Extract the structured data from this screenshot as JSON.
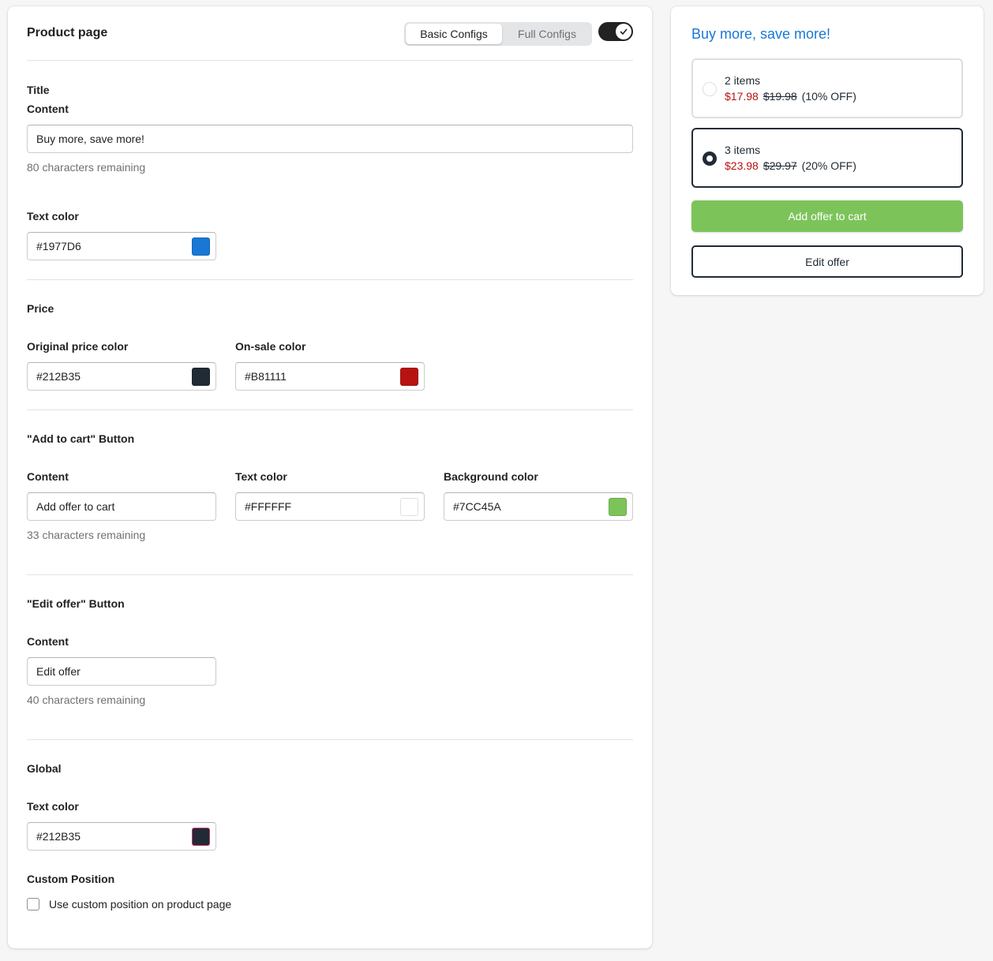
{
  "header": {
    "title": "Product page",
    "tabs": [
      {
        "label": "Basic Configs",
        "active": true
      },
      {
        "label": "Full Configs",
        "active": false
      }
    ],
    "toggle_on": true
  },
  "title_section": {
    "heading": "Title",
    "content_label": "Content",
    "content_value": "Buy more, save more!",
    "remaining": "80 characters remaining",
    "text_color_label": "Text color",
    "text_color": "#1977D6"
  },
  "price_section": {
    "heading": "Price",
    "original_label": "Original price color",
    "original_color": "#212B35",
    "sale_label": "On-sale color",
    "sale_color": "#B81111"
  },
  "add_to_cart_section": {
    "heading": "\"Add to cart\" Button",
    "content_label": "Content",
    "content_value": "Add offer to cart",
    "remaining": "33 characters remaining",
    "text_color_label": "Text color",
    "text_color": "#FFFFFF",
    "bg_color_label": "Background color",
    "bg_color": "#7CC45A"
  },
  "edit_offer_section": {
    "heading": "\"Edit offer\" Button",
    "content_label": "Content",
    "content_value": "Edit offer",
    "remaining": "40 characters remaining"
  },
  "global_section": {
    "heading": "Global",
    "text_color_label": "Text color",
    "text_color": "#212B35",
    "custom_position_heading": "Custom Position",
    "custom_position_label": "Use custom position on product page",
    "custom_position_checked": false
  },
  "preview": {
    "title": "Buy more, save more!",
    "options": [
      {
        "qty": "2 items",
        "sale_price": "$17.98",
        "original_price": "$19.98",
        "discount": "(10% OFF)",
        "selected": false
      },
      {
        "qty": "3 items",
        "sale_price": "$23.98",
        "original_price": "$29.97",
        "discount": "(20% OFF)",
        "selected": true
      }
    ],
    "add_button": "Add offer to cart",
    "edit_button": "Edit offer"
  }
}
